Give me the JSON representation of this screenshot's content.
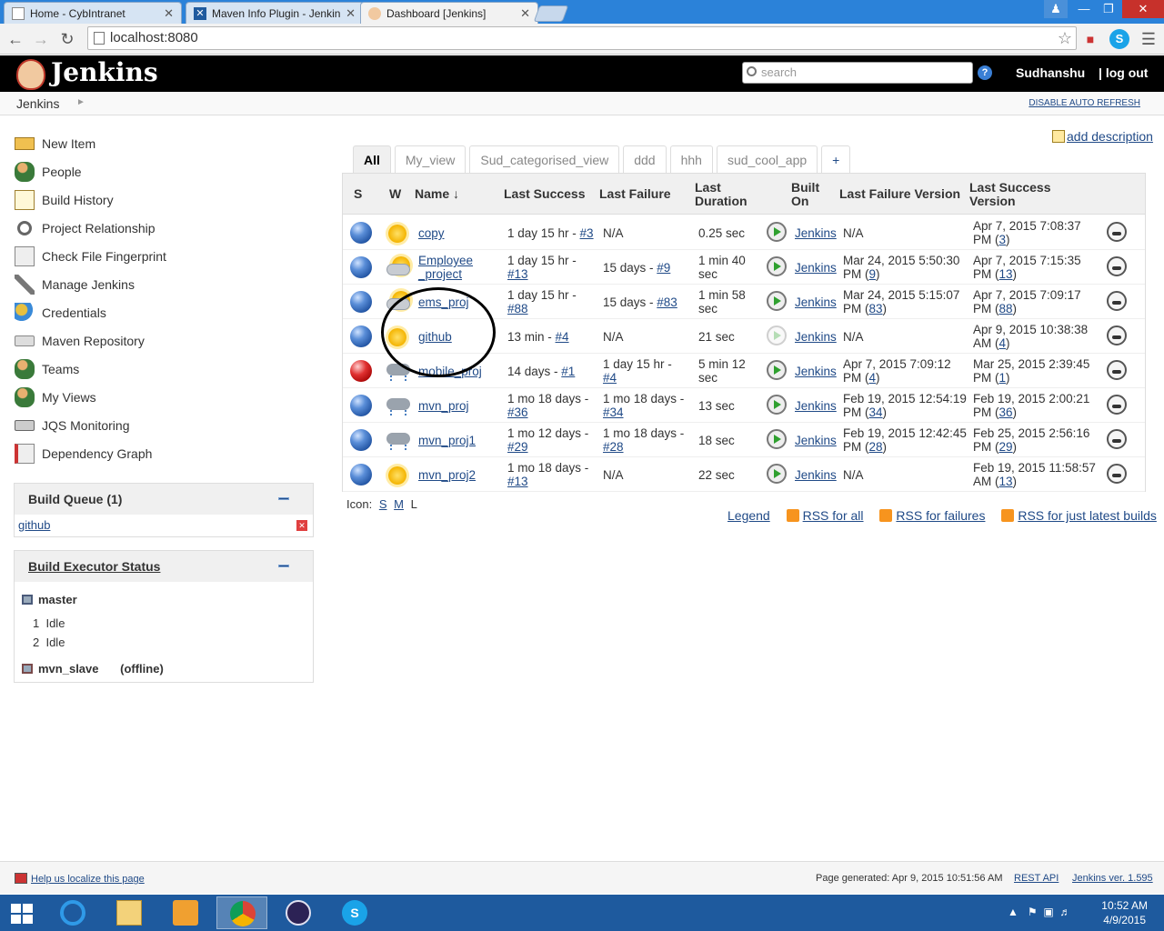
{
  "browser": {
    "tabs": [
      {
        "title": "Home - CybIntranet",
        "active": false
      },
      {
        "title": "Maven Info Plugin - Jenkins",
        "active": false
      },
      {
        "title": "Dashboard [Jenkins]",
        "active": true
      }
    ],
    "url": "localhost:8080"
  },
  "header": {
    "logo_text": "Jenkins",
    "search_placeholder": "search",
    "help_icon": "?",
    "user": "Sudhanshu",
    "logout": "log out"
  },
  "breadcrumb": {
    "root": "Jenkins",
    "auto_refresh": "DISABLE AUTO REFRESH"
  },
  "sidebar": {
    "tasks": [
      {
        "label": "New Item",
        "icon": "new-item-icon"
      },
      {
        "label": "People",
        "icon": "people-icon"
      },
      {
        "label": "Build History",
        "icon": "notepad-icon"
      },
      {
        "label": "Project Relationship",
        "icon": "magnifier-icon"
      },
      {
        "label": "Check File Fingerprint",
        "icon": "fingerprint-icon"
      },
      {
        "label": "Manage Jenkins",
        "icon": "wrench-icon"
      },
      {
        "label": "Credentials",
        "icon": "keys-icon"
      },
      {
        "label": "Maven Repository",
        "icon": "drive-icon"
      },
      {
        "label": "Teams",
        "icon": "people-icon"
      },
      {
        "label": "My Views",
        "icon": "people-icon"
      },
      {
        "label": "JQS Monitoring",
        "icon": "drive-icon"
      },
      {
        "label": "Dependency Graph",
        "icon": "graph-icon"
      }
    ],
    "build_queue": {
      "title": "Build Queue (1)",
      "items": [
        "github"
      ]
    },
    "executors": {
      "title": "Build Executor Status",
      "master": "master",
      "slots": [
        {
          "num": "1",
          "state": "Idle"
        },
        {
          "num": "2",
          "state": "Idle"
        }
      ],
      "slave": "mvn_slave",
      "slave_state": "(offline)"
    }
  },
  "main": {
    "add_description": "add description",
    "view_tabs": [
      "All",
      "My_view",
      "Sud_categorised_view",
      "ddd",
      "hhh",
      "sud_cool_app",
      "+"
    ],
    "columns": {
      "s": "S",
      "w": "W",
      "name": "Name",
      "sort_arrow": "↓",
      "last_success": "Last Success",
      "last_failure": "Last Failure",
      "last_duration_1": "Last",
      "last_duration_2": "Duration",
      "built_on_1": "Built",
      "built_on_2": "On",
      "lf_version": "Last Failure Version",
      "ls_version_1": "Last Success",
      "ls_version_2": "Version"
    },
    "jobs": [
      {
        "status": "blue",
        "weather": "sunny",
        "name": "copy",
        "ls_text": "1 day 15 hr - ",
        "ls_build": "#3",
        "ls_inline": true,
        "lf_text": "N/A",
        "lf_build": "",
        "duration": "0.25 sec",
        "built_on": "Jenkins",
        "lfv_text": "N/A",
        "lfv_link": "",
        "lsv_text": "Apr 7, 2015 7:08:37 PM (",
        "lsv_link": "3"
      },
      {
        "status": "blue",
        "weather": "partly-cloudy",
        "name": "Employee _project",
        "ls_text": "1 day 15 hr - ",
        "ls_build": "#13",
        "ls_inline": false,
        "lf_text": "15 days - ",
        "lf_build": "#9",
        "duration": "1 min 40 sec",
        "built_on": "Jenkins",
        "lfv_text": "Mar 24, 2015 5:50:30 PM (",
        "lfv_link": "9",
        "lsv_text": "Apr 7, 2015 7:15:35 PM (",
        "lsv_link": "13"
      },
      {
        "status": "blue",
        "weather": "partly-cloudy",
        "name": "ems_proj",
        "ls_text": "1 day 15 hr - ",
        "ls_build": "#88",
        "ls_inline": false,
        "lf_text": "15 days - ",
        "lf_build": "#83",
        "duration": "1 min 58 sec",
        "built_on": "Jenkins",
        "lfv_text": "Mar 24, 2015 5:15:07 PM (",
        "lfv_link": "83",
        "lsv_text": "Apr 7, 2015 7:09:17 PM (",
        "lsv_link": "88"
      },
      {
        "status": "blue",
        "weather": "sunny",
        "name": "github",
        "ls_text": "13 min - ",
        "ls_build": "#4",
        "ls_inline": true,
        "lf_text": "N/A",
        "lf_build": "",
        "duration": "21 sec",
        "built_on": "Jenkins",
        "lfv_text": "N/A",
        "lfv_link": "",
        "lsv_text": "Apr 9, 2015 10:38:38 AM (",
        "lsv_link": "4"
      },
      {
        "status": "red",
        "weather": "stormy",
        "name": "mobile_proj",
        "ls_text": "14 days - ",
        "ls_build": "#1",
        "ls_inline": true,
        "lf_text": "1 day 15 hr - ",
        "lf_build": "#4",
        "duration": "5 min 12 sec",
        "built_on": "Jenkins",
        "lfv_text": "Apr 7, 2015 7:09:12 PM (",
        "lfv_link": "4",
        "lsv_text": "Mar 25, 2015 2:39:45 PM (",
        "lsv_link": "1"
      },
      {
        "status": "blue",
        "weather": "stormy",
        "name": "mvn_proj",
        "ls_text": "1 mo 18 days - ",
        "ls_build": "#36",
        "ls_inline": false,
        "lf_text": "1 mo 18 days - ",
        "lf_build": "#34",
        "duration": "13 sec",
        "built_on": "Jenkins",
        "lfv_text": "Feb 19, 2015 12:54:19 PM (",
        "lfv_link": "34",
        "lsv_text": "Feb 19, 2015 2:00:21 PM (",
        "lsv_link": "36"
      },
      {
        "status": "blue",
        "weather": "stormy",
        "name": "mvn_proj1",
        "ls_text": "1 mo 12 days - ",
        "ls_build": "#29",
        "ls_inline": false,
        "lf_text": "1 mo 18 days - ",
        "lf_build": "#28",
        "duration": "18 sec",
        "built_on": "Jenkins",
        "lfv_text": "Feb 19, 2015 12:42:45 PM (",
        "lfv_link": "28",
        "lsv_text": "Feb 25, 2015 2:56:16 PM (",
        "lsv_link": "29"
      },
      {
        "status": "blue",
        "weather": "sunny",
        "name": "mvn_proj2",
        "ls_text": "1 mo 18 days - ",
        "ls_build": "#13",
        "ls_inline": false,
        "lf_text": "N/A",
        "lf_build": "",
        "duration": "22 sec",
        "built_on": "Jenkins",
        "lfv_text": "N/A",
        "lfv_link": "",
        "lsv_text": "Feb 19, 2015 11:58:57 AM (",
        "lsv_link": "13"
      }
    ],
    "icon_size": {
      "label": "Icon:",
      "options": [
        "S",
        "M",
        "L"
      ]
    },
    "legend": "Legend",
    "rss": [
      "RSS for all",
      "RSS for failures",
      "RSS for just latest builds"
    ]
  },
  "footer": {
    "localize": "Help us localize this page",
    "generated": "Page generated: Apr 9, 2015 10:51:56 AM",
    "rest_api": "REST API",
    "version": "Jenkins ver. 1.595"
  },
  "taskbar": {
    "time": "10:52 AM",
    "date": "4/9/2015"
  }
}
